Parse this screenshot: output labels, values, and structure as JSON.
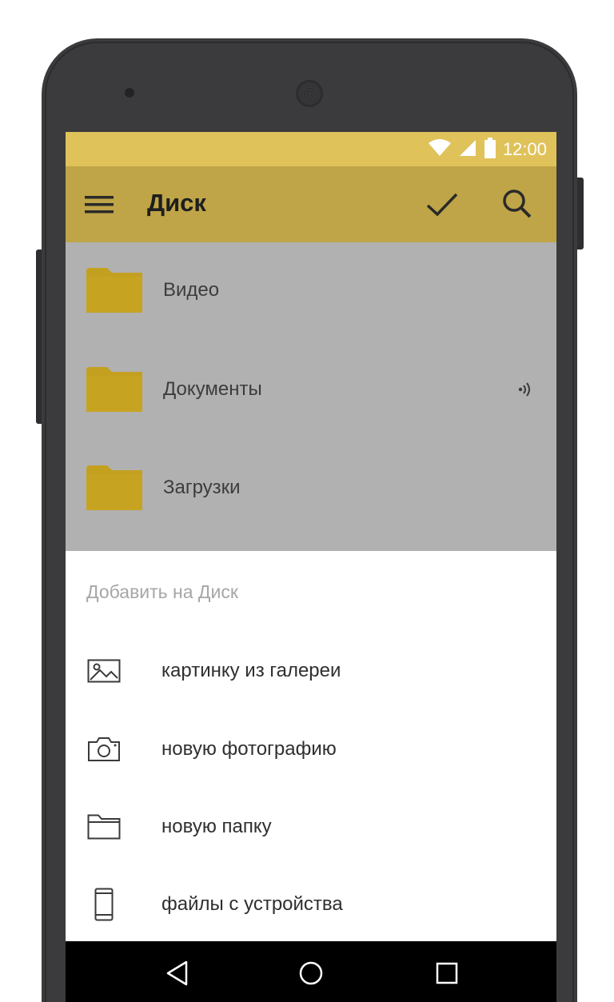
{
  "status_bar": {
    "time": "12:00",
    "icons": [
      "wifi-icon",
      "signal-icon",
      "battery-icon"
    ]
  },
  "app_bar": {
    "title": "Диск",
    "icons": [
      "menu-icon",
      "check-icon",
      "search-icon"
    ]
  },
  "folders": [
    {
      "label": "Видео",
      "icon": "folder-icon",
      "synced": false
    },
    {
      "label": "Документы",
      "icon": "folder-icon",
      "synced": true
    },
    {
      "label": "Загрузки",
      "icon": "folder-icon",
      "synced": false
    }
  ],
  "sheet": {
    "header": "Добавить на Диск",
    "items": [
      {
        "label": "картинку из галереи",
        "icon": "gallery-image-icon"
      },
      {
        "label": "новую фотографию",
        "icon": "camera-icon"
      },
      {
        "label": "новую папку",
        "icon": "folder-outline-icon"
      },
      {
        "label": "файлы с устройства",
        "icon": "phone-device-icon"
      }
    ]
  },
  "nav_bar": {
    "icons": [
      "back-icon",
      "home-icon",
      "recents-icon"
    ]
  },
  "colors": {
    "status_bar": "#e0c25a",
    "app_bar": "#bfa547",
    "folder": "#c4a020",
    "dim_overlay": "#b1b1b1",
    "sheet_header": "#a6a6a6"
  }
}
